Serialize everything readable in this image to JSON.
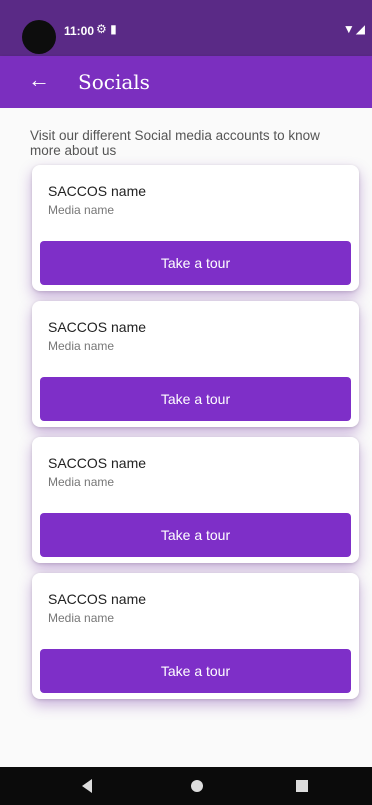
{
  "status_bar": {
    "time": "11:00",
    "icons": [
      "settings-gear-icon",
      "sd-card-icon"
    ],
    "right_icons": "▼◢"
  },
  "appbar": {
    "back_icon": "arrow-left-icon",
    "title": "Socials"
  },
  "intro_text": "Visit our different Social media accounts to know more about us",
  "cards": [
    {
      "saccos_name": "SACCOS name",
      "media_name": "Media name",
      "button_label": "Take a tour"
    },
    {
      "saccos_name": "SACCOS name",
      "media_name": "Media name",
      "button_label": "Take a tour"
    },
    {
      "saccos_name": "SACCOS name",
      "media_name": "Media name",
      "button_label": "Take a tour"
    },
    {
      "saccos_name": "SACCOS name",
      "media_name": "Media name",
      "button_label": "Take a tour"
    }
  ],
  "colors": {
    "status_bar": "#5a2a86",
    "app_bar": "#7b2fbf",
    "button": "#7e2fc8"
  }
}
